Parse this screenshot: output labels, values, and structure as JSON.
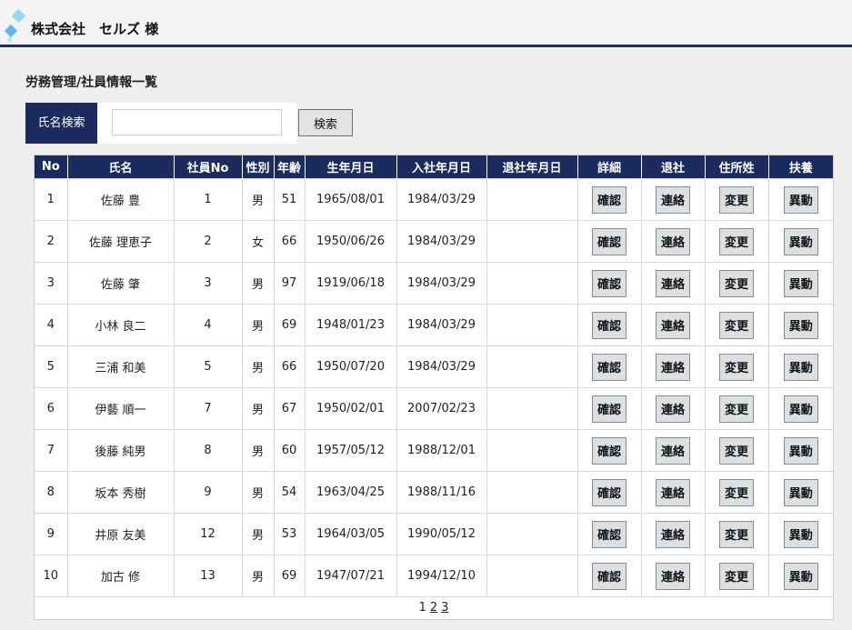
{
  "header": {
    "company": "株式会社　セルズ 様"
  },
  "page": {
    "title": "労務管理/社員情報一覧"
  },
  "search": {
    "label": "氏名検索",
    "value": "",
    "placeholder": "",
    "button_label": "検索"
  },
  "table": {
    "columns": [
      "No",
      "氏名",
      "社員No",
      "性別",
      "年齢",
      "生年月日",
      "入社年月日",
      "退社年月日",
      "詳細",
      "退社",
      "住所姓",
      "扶養"
    ],
    "rows": [
      {
        "no": "1",
        "name": "佐藤 豊",
        "emp_no": "1",
        "gender": "男",
        "age": "51",
        "birth": "1965/08/01",
        "join": "1984/03/29",
        "leave": ""
      },
      {
        "no": "2",
        "name": "佐藤 理恵子",
        "emp_no": "2",
        "gender": "女",
        "age": "66",
        "birth": "1950/06/26",
        "join": "1984/03/29",
        "leave": ""
      },
      {
        "no": "3",
        "name": "佐藤 肇",
        "emp_no": "3",
        "gender": "男",
        "age": "97",
        "birth": "1919/06/18",
        "join": "1984/03/29",
        "leave": ""
      },
      {
        "no": "4",
        "name": "小林 良二",
        "emp_no": "4",
        "gender": "男",
        "age": "69",
        "birth": "1948/01/23",
        "join": "1984/03/29",
        "leave": ""
      },
      {
        "no": "5",
        "name": "三浦 和美",
        "emp_no": "5",
        "gender": "男",
        "age": "66",
        "birth": "1950/07/20",
        "join": "1984/03/29",
        "leave": ""
      },
      {
        "no": "6",
        "name": "伊藝 順一",
        "emp_no": "7",
        "gender": "男",
        "age": "67",
        "birth": "1950/02/01",
        "join": "2007/02/23",
        "leave": ""
      },
      {
        "no": "7",
        "name": "後藤 純男",
        "emp_no": "8",
        "gender": "男",
        "age": "60",
        "birth": "1957/05/12",
        "join": "1988/12/01",
        "leave": ""
      },
      {
        "no": "8",
        "name": "坂本 秀樹",
        "emp_no": "9",
        "gender": "男",
        "age": "54",
        "birth": "1963/04/25",
        "join": "1988/11/16",
        "leave": ""
      },
      {
        "no": "9",
        "name": "井原 友美",
        "emp_no": "12",
        "gender": "男",
        "age": "53",
        "birth": "1964/03/05",
        "join": "1990/05/12",
        "leave": ""
      },
      {
        "no": "10",
        "name": "加古 修",
        "emp_no": "13",
        "gender": "男",
        "age": "69",
        "birth": "1947/07/21",
        "join": "1994/12/10",
        "leave": ""
      }
    ],
    "actions": {
      "detail": "確認",
      "retire": "連絡",
      "address": "変更",
      "dependent": "異動"
    }
  },
  "pagination": {
    "current": "1",
    "pages": [
      "2",
      "3"
    ]
  },
  "colors": {
    "navy": "#1b2b5e",
    "logo_light": "#9ed4f5",
    "logo_mid": "#5fb6ec"
  },
  "icons": {
    "logo": "diamond-logo-icon"
  }
}
